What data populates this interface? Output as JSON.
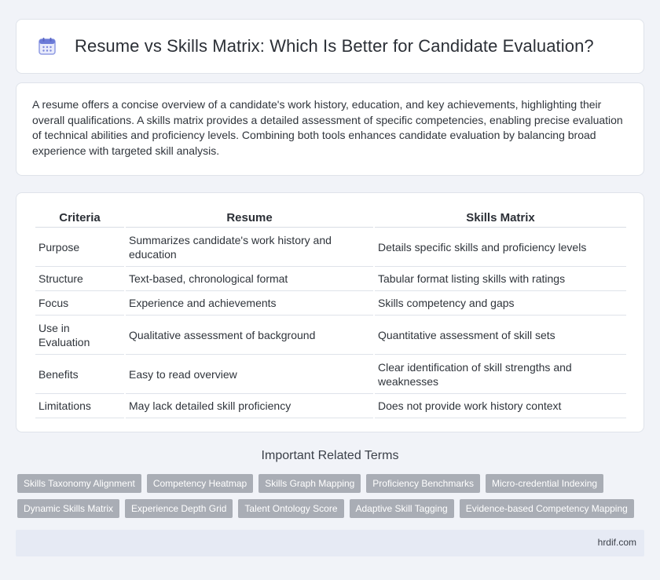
{
  "header": {
    "title": "Resume vs Skills Matrix: Which Is Better for Candidate Evaluation?",
    "icon": "calendar-icon"
  },
  "intro": {
    "text": "A resume offers a concise overview of a candidate's work history, education, and key achievements, highlighting their overall qualifications. A skills matrix provides a detailed assessment of specific competencies, enabling precise evaluation of technical abilities and proficiency levels. Combining both tools enhances candidate evaluation by balancing broad experience with targeted skill analysis."
  },
  "table": {
    "headers": [
      "Criteria",
      "Resume",
      "Skills Matrix"
    ],
    "rows": [
      [
        "Purpose",
        "Summarizes candidate's work history and education",
        "Details specific skills and proficiency levels"
      ],
      [
        "Structure",
        "Text-based, chronological format",
        "Tabular format listing skills with ratings"
      ],
      [
        "Focus",
        "Experience and achievements",
        "Skills competency and gaps"
      ],
      [
        "Use in Evaluation",
        "Qualitative assessment of background",
        "Quantitative assessment of skill sets"
      ],
      [
        "Benefits",
        "Easy to read overview",
        "Clear identification of skill strengths and weaknesses"
      ],
      [
        "Limitations",
        "May lack detailed skill proficiency",
        "Does not provide work history context"
      ]
    ]
  },
  "related": {
    "title": "Important Related Terms",
    "row1": [
      "Skills Taxonomy Alignment",
      "Competency Heatmap",
      "Skills Graph Mapping",
      "Proficiency Benchmarks",
      "Micro-credential Indexing"
    ],
    "row2": [
      "Dynamic Skills Matrix",
      "Experience Depth Grid",
      "Talent Ontology Score",
      "Adaptive Skill Tagging",
      "Evidence-based Competency Mapping"
    ]
  },
  "footer": {
    "site": "hrdif.com"
  },
  "colors": {
    "background": "#f1f3f8",
    "tag": "#a9adb5",
    "footer": "#e6eaf4",
    "icon_accent": "#6b7bd8"
  }
}
